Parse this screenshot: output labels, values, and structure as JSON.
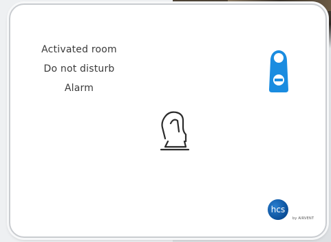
{
  "panel": {
    "status_items": [
      "Activated room",
      "Do not disturb",
      "Alarm"
    ]
  },
  "icons": {
    "badge": "door-hanger-icon",
    "center": "hand-touch-icon"
  },
  "colors": {
    "badge_blue": "#1a8ce0",
    "text_gray": "#3a3a3a",
    "logo_blue": "#0a4e98"
  },
  "logo": {
    "brand": "hcs",
    "tagline": "by AIRVENT"
  }
}
